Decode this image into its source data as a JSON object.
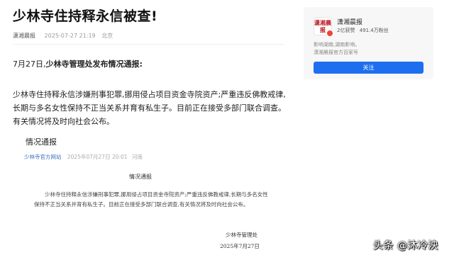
{
  "article": {
    "title": "少林寺住持释永信被查!",
    "source": "潇湘晨报",
    "time": "2025-07-27 21:19",
    "location": "北京",
    "lead_date": "7月27日,",
    "lead_bold": "少林寺管理处发布情况通报:",
    "body": "少林寺住持释永信涉嫌刑事犯罪,挪用侵占项目资金寺院资产;严重违反佛教戒律,长期与多名女性保持不正当关系并育有私生子。目前正在接受多部门联合调查。有关情况将及时向社会公布。"
  },
  "quote": {
    "title": "情况通报",
    "site": "少林寺官方网站",
    "time": "2025年07月27日 20:01",
    "region": "河南",
    "notice_heading": "情况通报",
    "notice_text": "少林寺住持释永信涉嫌刑事犯罪,挪用侵占项目资金寺院资产;严重违反佛教戒律,长期与多名女性保持不正当关系并育有私生子。目前正在接受多部门联合调查,有关情况将及时向社会公布。",
    "signature": "少林寺管理处",
    "signature_date": "2025年7月27日"
  },
  "sidebar": {
    "logo_text": "潇湘晨报",
    "account_name": "潇湘晨报",
    "likes": "2亿获赞",
    "fans": "491.4万粉丝",
    "desc_line1": "影响湖南,湖南影响。",
    "desc_line2": "潇湘晨报官方百家号",
    "follow_label": "关注"
  },
  "watermark": "头条 @沐冷泱"
}
